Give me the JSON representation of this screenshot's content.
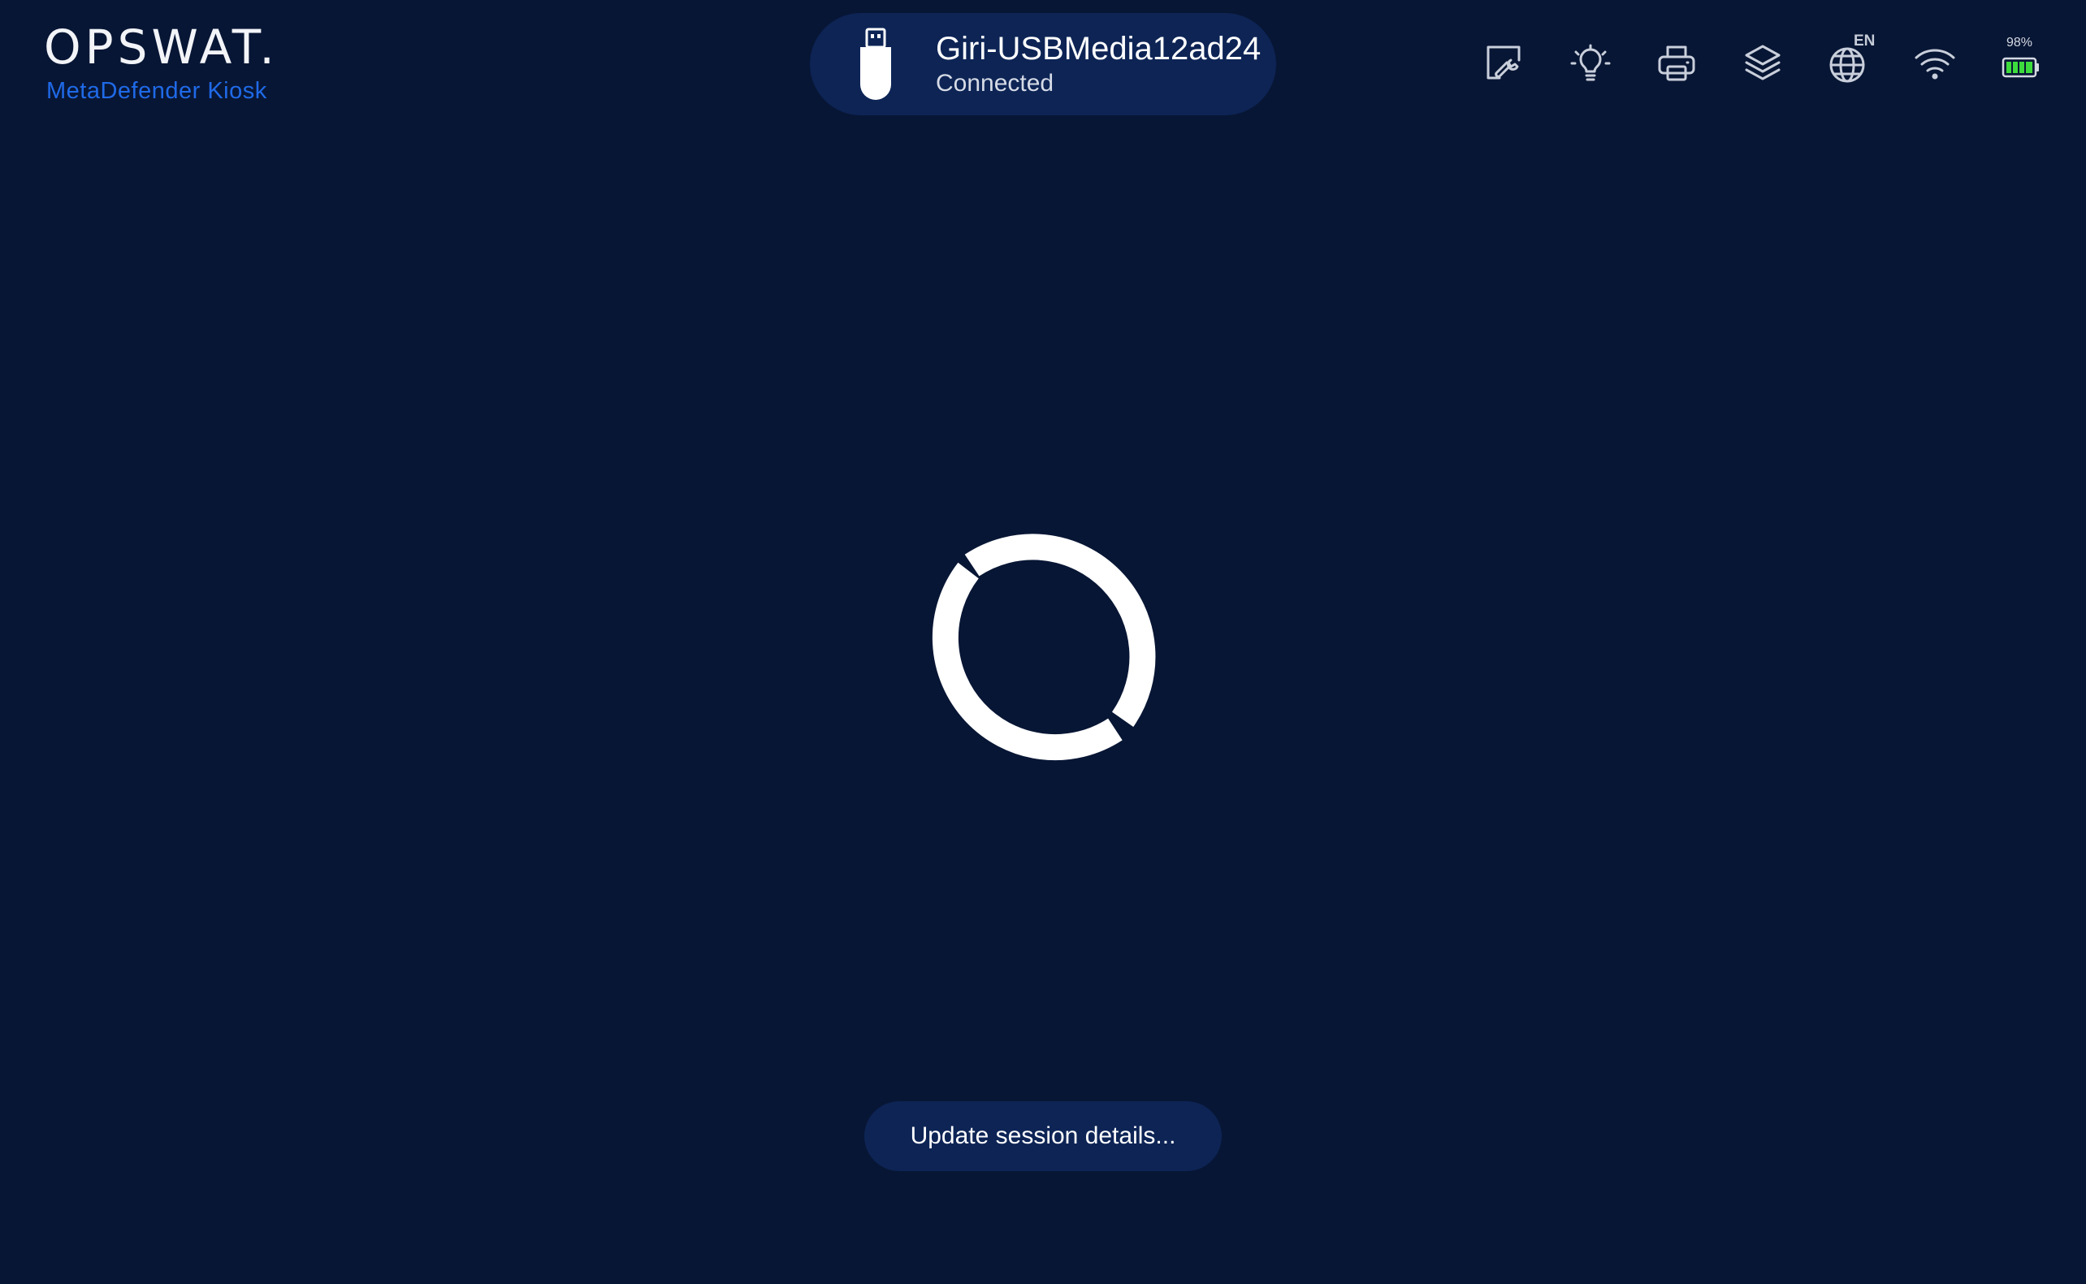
{
  "brand": {
    "logo_text": "OPSWAT.",
    "product_name": "MetaDefender Kiosk",
    "accent_color": "#1f6ae8"
  },
  "device": {
    "name": "Giri-USBMedia12ad24",
    "status": "Connected",
    "icon": "usb-drive-icon"
  },
  "toolbar": {
    "items": [
      {
        "icon": "maintenance-icon"
      },
      {
        "icon": "lightbulb-icon"
      },
      {
        "icon": "printer-icon"
      },
      {
        "icon": "layers-icon"
      },
      {
        "icon": "language-globe-icon",
        "language_code": "EN"
      },
      {
        "icon": "wifi-icon"
      },
      {
        "icon": "battery-icon",
        "battery_percent_label": "98%",
        "battery_level": 0.98,
        "battery_color": "#3ddc3d"
      }
    ]
  },
  "loader": {
    "icon": "loading-spinner-icon"
  },
  "status_message": "Update session details...",
  "colors": {
    "background": "#081635",
    "pill_background": "#0d2455"
  }
}
